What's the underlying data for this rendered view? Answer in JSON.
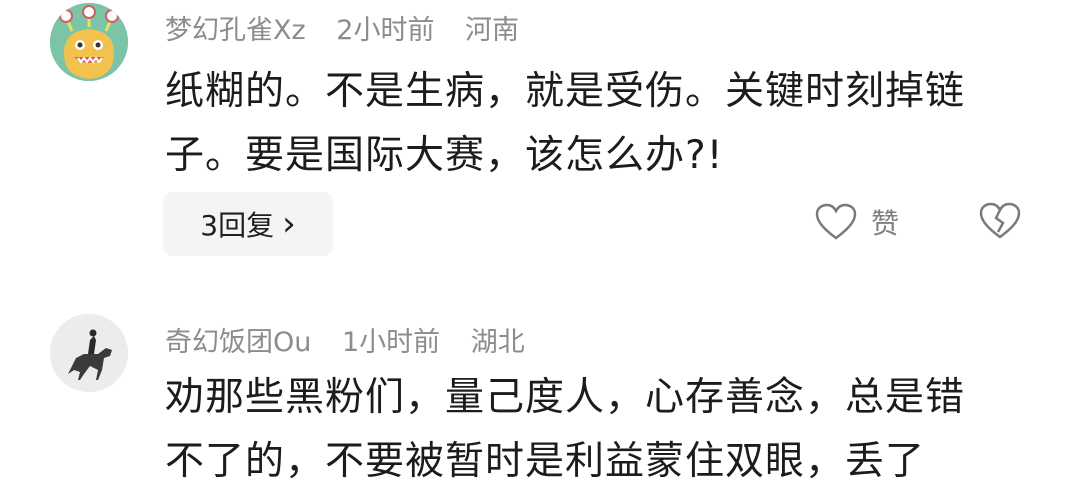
{
  "comments": [
    {
      "username": "梦幻孔雀Xz",
      "time": "2小时前",
      "location": "河南",
      "text_line1": "纸糊的。不是生病，就是受伤。关键时刻掉链",
      "text_line2": "子。要是国际大赛，该怎么办?!",
      "reply_label": "3回复",
      "reply_arrow": "›",
      "like_label": "赞",
      "avatar_icon": "alien-monster-avatar",
      "colors": {
        "avatar_bg": "#7cc4a8",
        "avatar_face": "#f2c14e"
      }
    },
    {
      "username": "奇幻饭团Ou",
      "time": "1小时前",
      "location": "湖北",
      "text_line1": "劝那些黑粉们，量己度人，心存善念，总是错",
      "text_line2": "不了的，不要被暂时是利益蒙住双眼，丢了",
      "avatar_icon": "horse-rider-avatar"
    }
  ]
}
